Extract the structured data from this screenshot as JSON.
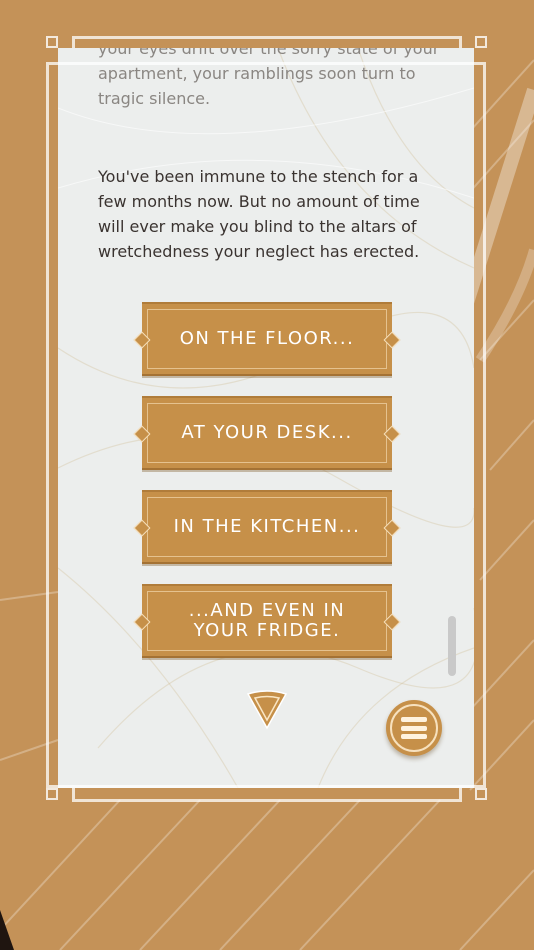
{
  "story": {
    "faded_paragraph": "your eyes drift over the sorry state of your apartment, your ramblings soon turn to tragic silence.",
    "main_paragraph": "You've been immune to the stench for a few months now. But no amount of time will ever make you blind to the altars of wretchedness your neglect has erected."
  },
  "choices": [
    {
      "label": "ON THE FLOOR..."
    },
    {
      "label": "AT YOUR DESK..."
    },
    {
      "label": "IN THE KITCHEN..."
    },
    {
      "label": "...AND EVEN IN YOUR FRIDGE."
    }
  ],
  "icons": {
    "continue": "down-chevron-icon",
    "menu": "hamburger-menu-icon"
  },
  "colors": {
    "background": "#c49258",
    "card": "#eceeed",
    "button": "#c69049",
    "button_text": "#ffffff",
    "body_text": "#3a3330"
  }
}
